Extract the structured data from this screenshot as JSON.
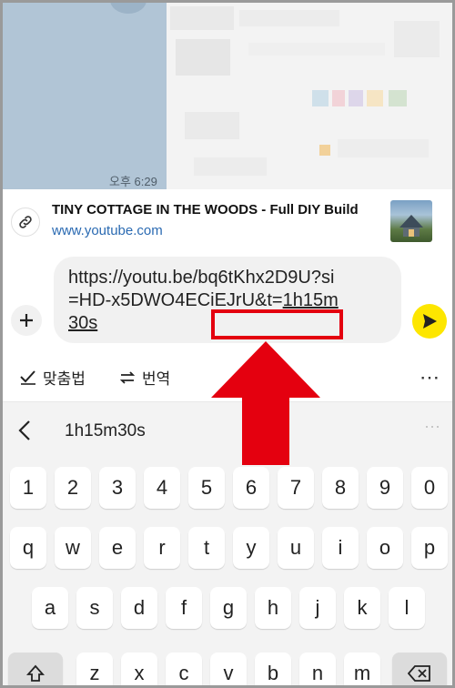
{
  "chat": {
    "time": "오후 6:29"
  },
  "preview": {
    "title": "TINY COTTAGE IN THE WOODS - Full DIY Build",
    "domain": "www.youtube.com",
    "icon": "link-icon"
  },
  "composer": {
    "text_plain": "https://youtu.be/bq6tKhx2D9U?si=HD-x5DWO4ECiEJrU",
    "text_highlight_prefix": "&t=",
    "text_highlight_value": "1h15m30s"
  },
  "toolbar": {
    "spellcheck_label": "맞춤법",
    "translate_label": "번역",
    "more": "⋯"
  },
  "suggestion": {
    "word": "1h15m30s",
    "more": "⋯"
  },
  "keyboard": {
    "row1": [
      "1",
      "2",
      "3",
      "4",
      "5",
      "6",
      "7",
      "8",
      "9",
      "0"
    ],
    "row2": [
      "q",
      "w",
      "e",
      "r",
      "t",
      "y",
      "u",
      "i",
      "o",
      "p"
    ],
    "row3": [
      "a",
      "s",
      "d",
      "f",
      "g",
      "h",
      "j",
      "k",
      "l"
    ],
    "row4": [
      "z",
      "x",
      "c",
      "v",
      "b",
      "n",
      "m"
    ]
  },
  "colors": {
    "send": "#fde600",
    "highlight": "#e4000f",
    "link": "#2a6ab2"
  }
}
